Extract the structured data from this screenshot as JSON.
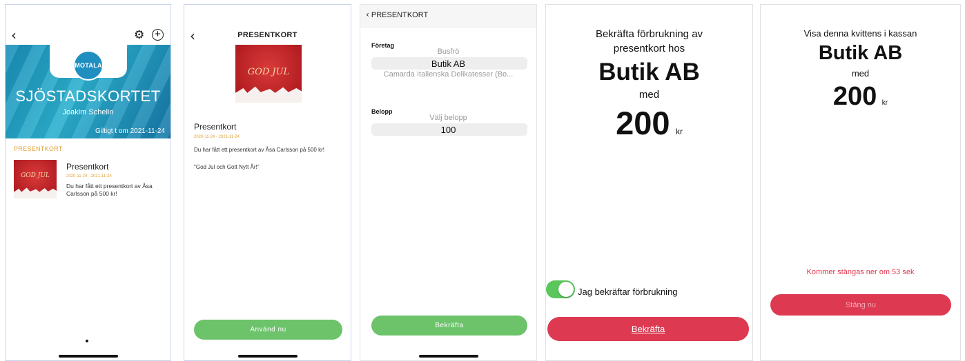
{
  "screen1": {
    "hero_logo": "MOTALA",
    "hero_title": "SJÖSTADSKORTET",
    "hero_name": "Joakim Schelin",
    "hero_valid": "Giltigt t om 2021-11-24",
    "section_label": "PRESENTKORT",
    "card_image_text": "GOD JUL",
    "item_title": "Presentkort",
    "item_date": "2020-11-24 - 2021-11-24",
    "item_text": "Du har fått ett presentkort av Åsa Carlsson på 500 kr!"
  },
  "screen2": {
    "header": "PRESENTKORT",
    "image_text": "GOD JUL",
    "title": "Presentkort",
    "date": "2020-11-24 - 2021-11-24",
    "text": "Du har fått ett presentkort av Åsa Carlsson på 500 kr!",
    "message": "\"God Jul och Gott Nytt År!\"",
    "use_button": "Använd nu"
  },
  "screen3": {
    "back_label": "PRESENTKORT",
    "company_label": "Företag",
    "company_options": [
      "Busfrö",
      "Butik AB",
      "Camarda Italienska Delikatesser (Bo..."
    ],
    "amount_label": "Belopp",
    "amount_options": [
      "Välj belopp",
      "100"
    ],
    "confirm_button": "Bekräfta"
  },
  "screen4": {
    "line1": "Bekräfta förbrukning av",
    "line2": "presentkort hos",
    "store": "Butik AB",
    "med": "med",
    "amount": "200",
    "unit": "kr",
    "toggle_label": "Jag bekräftar förbrukning",
    "toggle_on": true,
    "confirm_button": "Bekräfta"
  },
  "screen5": {
    "line1": "Visa denna kvittens i kassan",
    "store": "Butik AB",
    "med": "med",
    "amount": "200",
    "unit": "kr",
    "countdown": "Kommer stängas ner om 53 sek",
    "close_button": "Stäng nu"
  },
  "colors": {
    "green": "#6cc36a",
    "red": "#dd3a52",
    "accent": "#e1a33a",
    "hero": "#1a8fb8"
  }
}
